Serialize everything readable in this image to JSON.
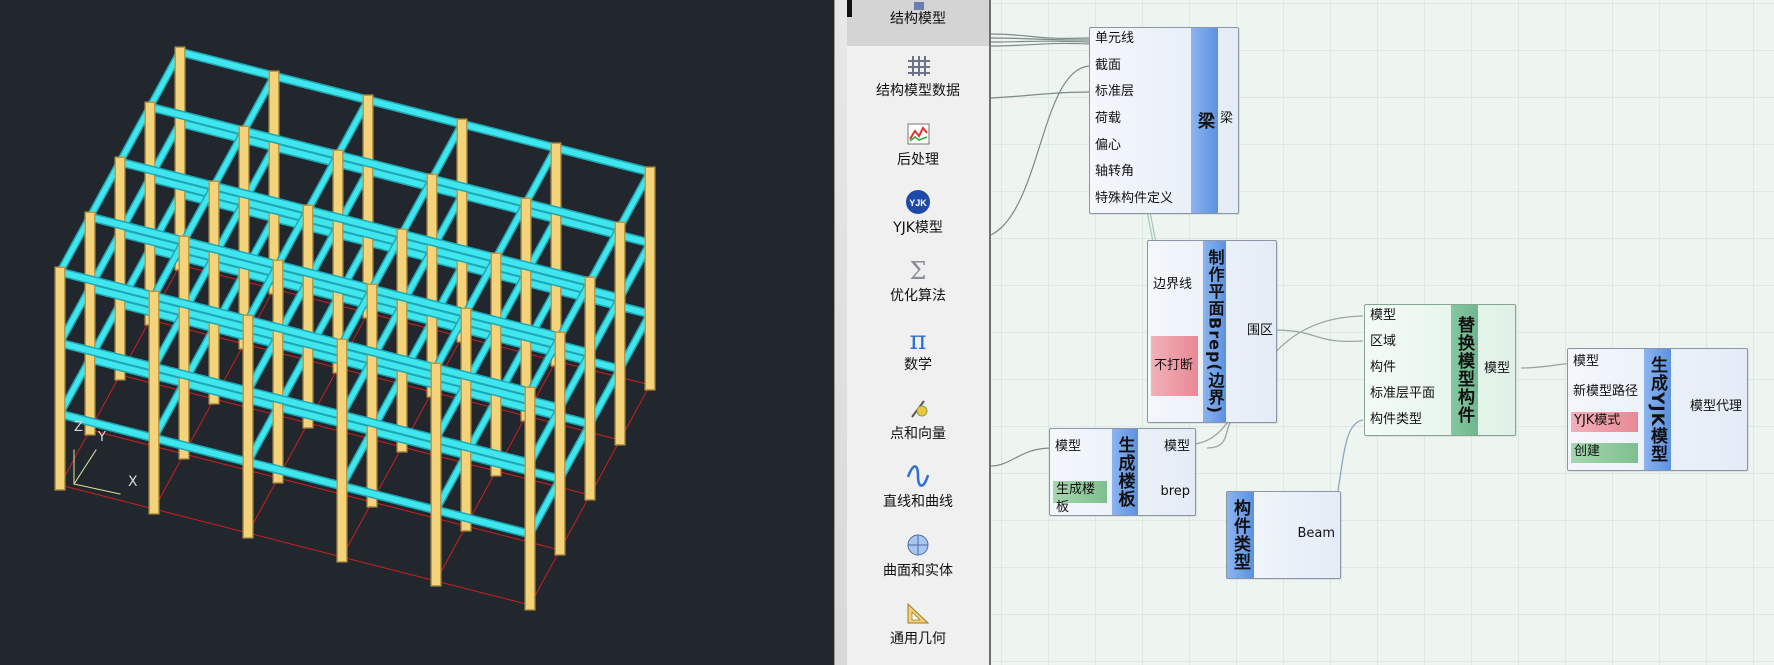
{
  "sidebar": {
    "items": [
      {
        "label": "结构模型",
        "icon": "structure-model-icon",
        "active": true
      },
      {
        "label": "结构模型数据",
        "icon": "grid-data-icon"
      },
      {
        "label": "后处理",
        "icon": "chart-icon"
      },
      {
        "label": "YJK模型",
        "icon": "yjk-logo-icon"
      },
      {
        "label": "优化算法",
        "icon": "sigma-icon"
      },
      {
        "label": "数学",
        "icon": "pi-icon"
      },
      {
        "label": "点和向量",
        "icon": "point-vector-icon"
      },
      {
        "label": "直线和曲线",
        "icon": "curve-icon"
      },
      {
        "label": "曲面和实体",
        "icon": "surface-icon"
      },
      {
        "label": "通用几何",
        "icon": "ruler-icon"
      }
    ]
  },
  "viewport": {
    "axis_z": "Z",
    "axis_y": "Y",
    "axis_x": "X",
    "colors": {
      "beam": "#3fe6ee",
      "column": "#f4d37a",
      "grid": "#cc2020",
      "background": "#22262d"
    }
  },
  "nodes": {
    "beam": {
      "title": "梁",
      "inputs": [
        "单元线",
        "截面",
        "标准层",
        "荷载",
        "偏心",
        "轴转角",
        "特殊构件定义"
      ],
      "outputs": [
        "梁"
      ]
    },
    "brep": {
      "title": "制作平面Brep(边界)",
      "inputs": [
        "边界线"
      ],
      "toggle": "不打断",
      "outputs": [
        "围区"
      ]
    },
    "slab": {
      "title": "生成楼板",
      "inputs": [
        "模型"
      ],
      "toggle": "生成楼板",
      "outputs": [
        "模型",
        "brep"
      ]
    },
    "replace": {
      "title": "替换模型构件",
      "inputs": [
        "模型",
        "区域",
        "构件",
        "标准层平面",
        "构件类型"
      ],
      "outputs": [
        "模型"
      ]
    },
    "comptype": {
      "title": "构件类型",
      "outputs": [
        "Beam"
      ]
    },
    "yjk": {
      "title": "生成YJK模型",
      "inputs": [
        "模型",
        "新模型路径"
      ],
      "toggle_red": "YJK模式",
      "toggle_green": "创建",
      "outputs": [
        "模型代理"
      ]
    }
  }
}
